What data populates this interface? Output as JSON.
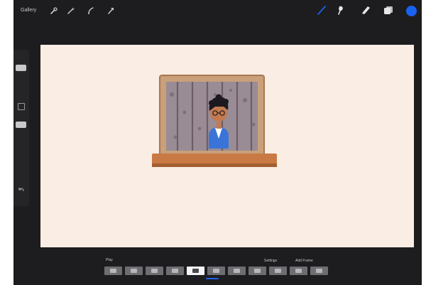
{
  "toolbar": {
    "gallery_label": "Gallery",
    "left_tools": [
      "wrench-icon",
      "magic-wand-icon",
      "selection-icon",
      "transform-arrow-icon"
    ],
    "right_tools": [
      "brush-icon",
      "smudge-icon",
      "eraser-icon",
      "layers-icon"
    ],
    "active_tool": "brush-icon",
    "current_color": "#1a63f0"
  },
  "sidebar": {
    "controls": [
      "brush-size-slider",
      "modify-button",
      "opacity-slider",
      "undo-button"
    ]
  },
  "canvas": {
    "background_color": "#faede4"
  },
  "timeline": {
    "play_label": "Play",
    "settings_label": "Settings",
    "add_frame_label": "Add Frame",
    "frame_count": 11,
    "active_frame": 4
  }
}
